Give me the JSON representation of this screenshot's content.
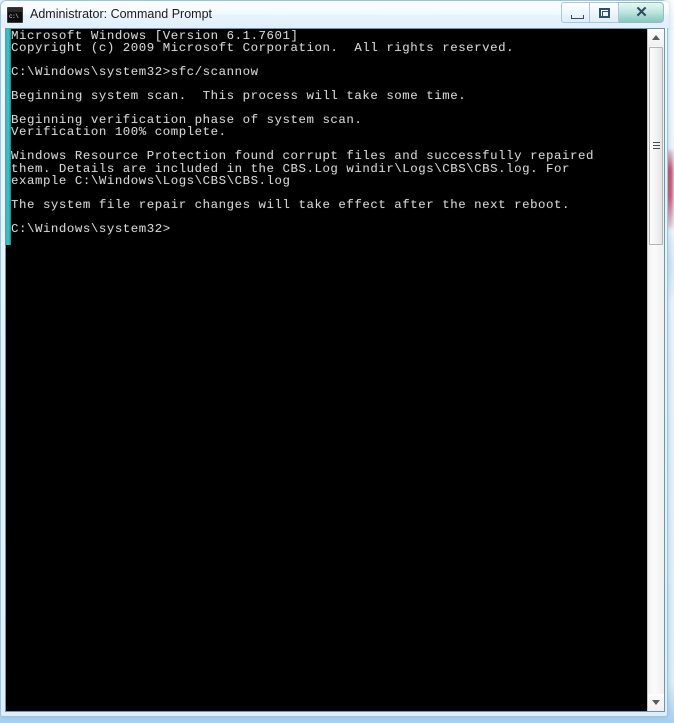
{
  "window": {
    "title": "Administrator: Command Prompt",
    "icon": "command-prompt-icon",
    "icon_text": "c:\\",
    "buttons": {
      "minimize_label": "",
      "maximize_label": "",
      "close_label": "✕"
    }
  },
  "console": {
    "lines": [
      "Microsoft Windows [Version 6.1.7601]",
      "Copyright (c) 2009 Microsoft Corporation.  All rights reserved.",
      "",
      "C:\\Windows\\system32>sfc/scannow",
      "",
      "Beginning system scan.  This process will take some time.",
      "",
      "Beginning verification phase of system scan.",
      "Verification 100% complete.",
      "",
      "Windows Resource Protection found corrupt files and successfully repaired",
      "them. Details are included in the CBS.Log windir\\Logs\\CBS\\CBS.log. For",
      "example C:\\Windows\\Logs\\CBS\\CBS.log",
      "",
      "The system file repair changes will take effect after the next reboot.",
      "",
      "C:\\Windows\\system32>"
    ],
    "text_color": "#d6d6d6",
    "background_color": "#000000",
    "selection_bar_color": "#2fb6b6"
  },
  "scrollbar": {
    "up_arrow": "scroll-up-arrow",
    "down_arrow": "scroll-down-arrow",
    "thumb": "scroll-thumb"
  },
  "background": {
    "description": "blurred browser window behind",
    "accent_red": "#c9415c",
    "accent_blue": "#cfe6f7"
  }
}
